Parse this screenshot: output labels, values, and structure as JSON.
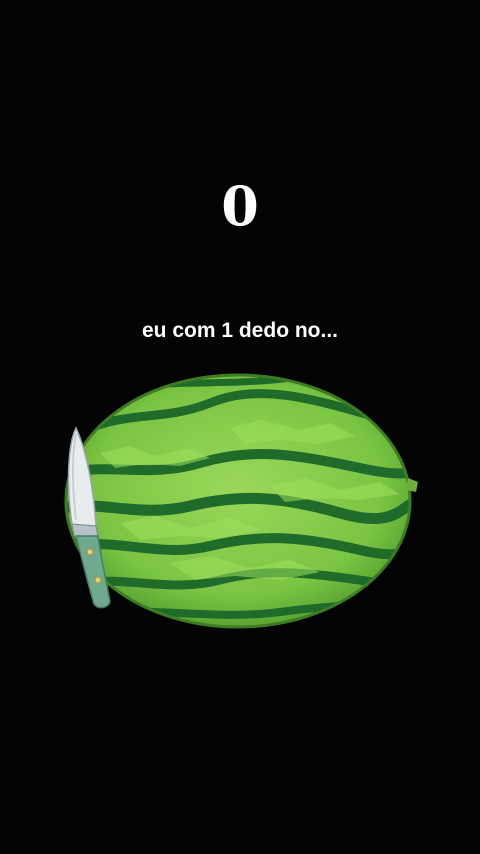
{
  "game": {
    "score": "0",
    "caption": "eu com 1 dedo no..."
  },
  "objects": {
    "fruit_icon": "watermelon-icon",
    "blade_icon": "knife-icon"
  },
  "colors": {
    "background": "#030303",
    "text": "#ffffff",
    "rind_light": "#8fd14f",
    "rind_dark": "#1f6b2a",
    "blade": "#e9ecef",
    "handle": "#6fa98e"
  }
}
